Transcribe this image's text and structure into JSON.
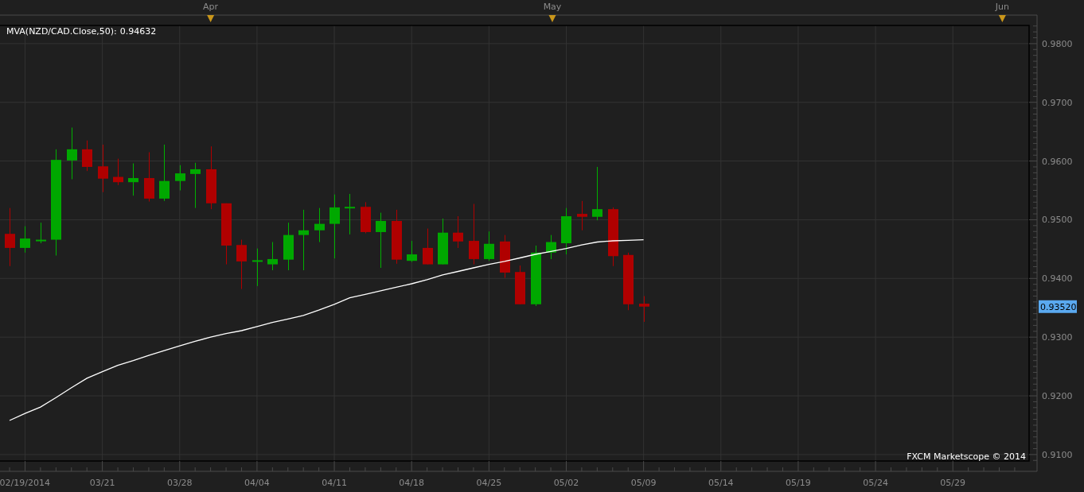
{
  "chart": {
    "indicator_value": "0.94632",
    "month_markers": [
      "Apr",
      "May",
      "Jun"
    ],
    "credit": "FXCM Marketscope © 2014",
    "current_price": "0.93520",
    "chart_data": {
      "type": "candlestick",
      "categories": [
        null,
        "02/19/2014",
        null,
        null,
        null,
        null,
        "03/21",
        null,
        null,
        null,
        null,
        "03/28",
        null,
        null,
        null,
        null,
        "04/04",
        null,
        null,
        null,
        null,
        "04/11",
        null,
        null,
        null,
        null,
        "04/18",
        null,
        null,
        null,
        null,
        "04/25",
        null,
        null,
        null,
        null,
        "05/02",
        null,
        null,
        null,
        null,
        "05/09",
        null,
        null,
        null,
        null,
        "05/14",
        null,
        null,
        null,
        null,
        "05/19",
        null,
        null,
        null,
        null,
        "05/24",
        null,
        null,
        null,
        null,
        "05/29",
        null,
        null,
        null,
        null
      ],
      "ohlc": [
        [
          0.9476,
          0.952,
          0.9421,
          0.9452
        ],
        [
          0.9452,
          0.9489,
          0.9444,
          0.9468
        ],
        [
          0.9464,
          0.9495,
          0.946,
          0.9466
        ],
        [
          0.9466,
          0.962,
          0.9439,
          0.9602
        ],
        [
          0.9601,
          0.9657,
          0.9569,
          0.962
        ],
        [
          0.962,
          0.9635,
          0.9583,
          0.959
        ],
        [
          0.9591,
          0.9628,
          0.9547,
          0.957
        ],
        [
          0.9573,
          0.9604,
          0.9559,
          0.9564
        ],
        [
          0.9564,
          0.9596,
          0.9541,
          0.9571
        ],
        [
          0.9571,
          0.9615,
          0.9531,
          0.9536
        ],
        [
          0.9536,
          0.9628,
          0.9532,
          0.9566
        ],
        [
          0.9566,
          0.9593,
          0.955,
          0.9579
        ],
        [
          0.9578,
          0.9597,
          0.952,
          0.9586
        ],
        [
          0.9586,
          0.9625,
          0.9518,
          0.9528
        ],
        [
          0.9528,
          0.9528,
          0.9424,
          0.9456
        ],
        [
          0.9457,
          0.9466,
          0.9382,
          0.9429
        ],
        [
          0.9429,
          0.9451,
          0.9387,
          0.9431
        ],
        [
          0.9424,
          0.9462,
          0.9414,
          0.9433
        ],
        [
          0.9432,
          0.9495,
          0.9414,
          0.9474
        ],
        [
          0.9474,
          0.9517,
          0.9414,
          0.9482
        ],
        [
          0.9482,
          0.952,
          0.9462,
          0.9493
        ],
        [
          0.9493,
          0.9543,
          0.9434,
          0.9521
        ],
        [
          0.9521,
          0.9544,
          0.9475,
          0.9522
        ],
        [
          0.9522,
          0.953,
          0.9477,
          0.9479
        ],
        [
          0.9479,
          0.9512,
          0.9418,
          0.9498
        ],
        [
          0.9498,
          0.9517,
          0.9425,
          0.9432
        ],
        [
          0.943,
          0.9464,
          0.9428,
          0.9441
        ],
        [
          0.9452,
          0.9485,
          0.9424,
          0.9424
        ],
        [
          0.9424,
          0.9502,
          0.9424,
          0.9478
        ],
        [
          0.9478,
          0.9506,
          0.9452,
          0.9463
        ],
        [
          0.9464,
          0.9527,
          0.9424,
          0.9433
        ],
        [
          0.9433,
          0.948,
          0.943,
          0.9459
        ],
        [
          0.9463,
          0.9474,
          0.9401,
          0.941
        ],
        [
          0.9411,
          0.9422,
          0.9356,
          0.9356
        ],
        [
          0.9356,
          0.9456,
          0.9353,
          0.9444
        ],
        [
          0.9444,
          0.9474,
          0.9433,
          0.9462
        ],
        [
          0.946,
          0.952,
          0.9441,
          0.9506
        ],
        [
          0.951,
          0.9532,
          0.9482,
          0.9505
        ],
        [
          0.9505,
          0.959,
          0.9499,
          0.9518
        ],
        [
          0.9518,
          0.9521,
          0.9421,
          0.9438
        ],
        [
          0.944,
          0.9444,
          0.9346,
          0.9356
        ],
        [
          0.9357,
          0.937,
          0.9326,
          0.9352
        ],
        null,
        null,
        null,
        null,
        null,
        null,
        null,
        null,
        null,
        null,
        null,
        null,
        null,
        null,
        null,
        null,
        null,
        null,
        null,
        null,
        null,
        null,
        null,
        null
      ],
      "series": [
        {
          "name": "MVA(NZD/CAD.Close,50):",
          "type": "line",
          "color": "#ffffff",
          "values": [
            0.9158,
            0.917,
            0.9181,
            0.9197,
            0.9214,
            0.923,
            0.9241,
            0.9252,
            0.926,
            0.9269,
            0.9277,
            0.9285,
            0.9293,
            0.93,
            0.9306,
            0.9311,
            0.9318,
            0.9325,
            0.9331,
            0.9337,
            0.9346,
            0.9356,
            0.9367,
            0.9373,
            0.9379,
            0.9385,
            0.9391,
            0.9398,
            0.9406,
            0.9412,
            0.9418,
            0.9424,
            0.9429,
            0.9435,
            0.9441,
            0.9446,
            0.9451,
            0.9457,
            0.9462,
            0.9464,
            0.9465,
            0.9466,
            null,
            null,
            null,
            null,
            null,
            null,
            null,
            null,
            null,
            null,
            null,
            null,
            null,
            null,
            null,
            null,
            null,
            null,
            null,
            null,
            null,
            null,
            null,
            null
          ]
        }
      ],
      "ylim": [
        0.9089,
        0.9831
      ],
      "yticks": [
        {
          "value": 0.91,
          "label": "0.9100"
        },
        {
          "value": 0.92,
          "label": "0.9200"
        },
        {
          "value": 0.93,
          "label": "0.9300"
        },
        {
          "value": 0.94,
          "label": "0.9400"
        },
        {
          "value": 0.95,
          "label": "0.9500"
        },
        {
          "value": 0.96,
          "label": "0.9600"
        },
        {
          "value": 0.97,
          "label": "0.9700"
        },
        {
          "value": 0.98,
          "label": "0.9800"
        }
      ],
      "grid": true
    }
  }
}
